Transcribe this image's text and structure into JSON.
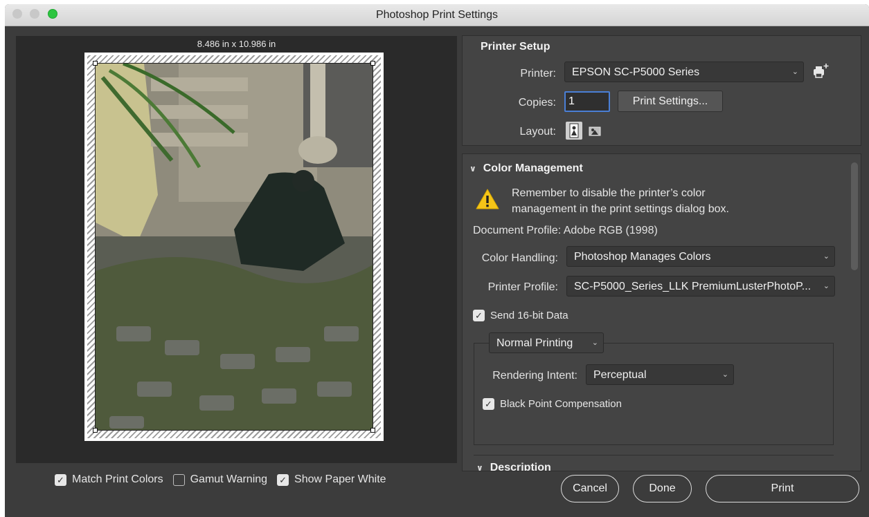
{
  "window": {
    "title": "Photoshop Print Settings"
  },
  "preview": {
    "dimensions": "8.486 in x 10.986 in"
  },
  "bottom_options": [
    {
      "label": "Match Print Colors",
      "checked": true
    },
    {
      "label": "Gamut Warning",
      "checked": false
    },
    {
      "label": "Show Paper White",
      "checked": true
    }
  ],
  "printer_setup": {
    "title": "Printer Setup",
    "printer_label": "Printer:",
    "printer_value": "EPSON SC-P5000 Series",
    "copies_label": "Copies:",
    "copies_value": "1",
    "print_settings_button": "Print Settings...",
    "layout_label": "Layout:"
  },
  "color_management": {
    "title": "Color Management",
    "warning_line1": "Remember to disable the printer’s color",
    "warning_line2": "management in the print settings dialog box.",
    "document_profile": "Document Profile: Adobe RGB (1998)",
    "color_handling_label": "Color Handling:",
    "color_handling_value": "Photoshop Manages Colors",
    "printer_profile_label": "Printer Profile:",
    "printer_profile_value": "SC-P5000_Series_LLK PremiumLusterPhotoP...",
    "send16_label": "Send 16-bit Data",
    "send16_checked": true,
    "printing_mode": "Normal Printing",
    "rendering_intent_label": "Rendering Intent:",
    "rendering_intent_value": "Perceptual",
    "bpc_label": "Black Point Compensation",
    "bpc_checked": true
  },
  "description": {
    "title": "Description"
  },
  "buttons": {
    "cancel": "Cancel",
    "done": "Done",
    "print": "Print"
  },
  "icons": {
    "printer_add": "printer-add-icon",
    "layout_portrait": "portrait-layout-icon",
    "layout_landscape": "landscape-layout-icon",
    "warning": "warning-icon"
  },
  "colors": {
    "window_bg": "#3c3c3c",
    "accent_focus": "#4a7fd6",
    "warning_yellow": "#f5c518"
  }
}
